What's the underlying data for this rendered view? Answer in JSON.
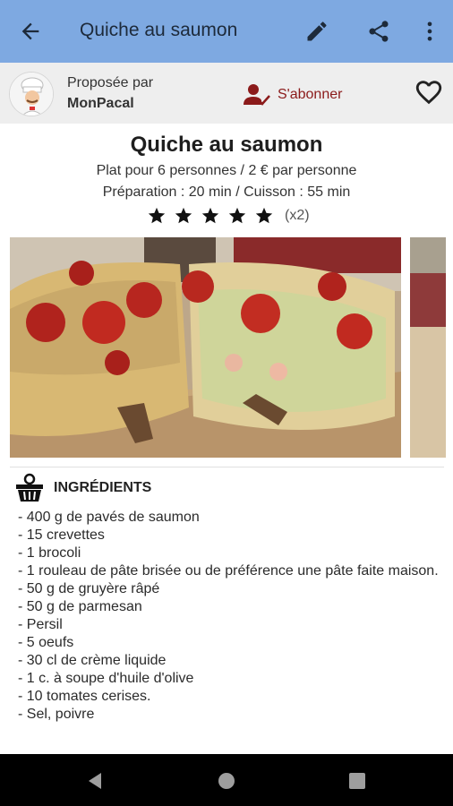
{
  "app_bar": {
    "title": "Quiche au saumon",
    "back_icon": "arrow-back-icon",
    "actions": [
      "edit-icon",
      "share-icon",
      "more-vert-icon"
    ]
  },
  "author": {
    "proposed_label": "Proposée par",
    "name": "MonPacal",
    "subscribe_label": "S'abonner"
  },
  "recipe": {
    "title": "Quiche au saumon",
    "servings": "Plat pour 6 personnes / 2 € par personne",
    "timing": "Préparation : 20 min / Cuisson : 55 min",
    "rating": 5,
    "rating_max": 5,
    "votes": "(x2)"
  },
  "ingredients": {
    "heading": "INGRÉDIENTS",
    "items": [
      "- 400 g de pavés de saumon",
      "- 15 crevettes",
      "- 1 brocoli",
      "- 1 rouleau de pâte brisée ou de préférence une pâte faite maison.",
      "- 50 g de gruyère râpé",
      "- 50 g de parmesan",
      "- Persil",
      "- 5 oeufs",
      "- 30 cl de crème liquide",
      "- 1 c. à soupe d'huile d'olive",
      "- 10 tomates cerises.",
      "- Sel, poivre"
    ]
  },
  "colors": {
    "app_bar": "#7ea9e1",
    "subscribe": "#8b1a1a",
    "author_bg": "#eeeeee"
  }
}
